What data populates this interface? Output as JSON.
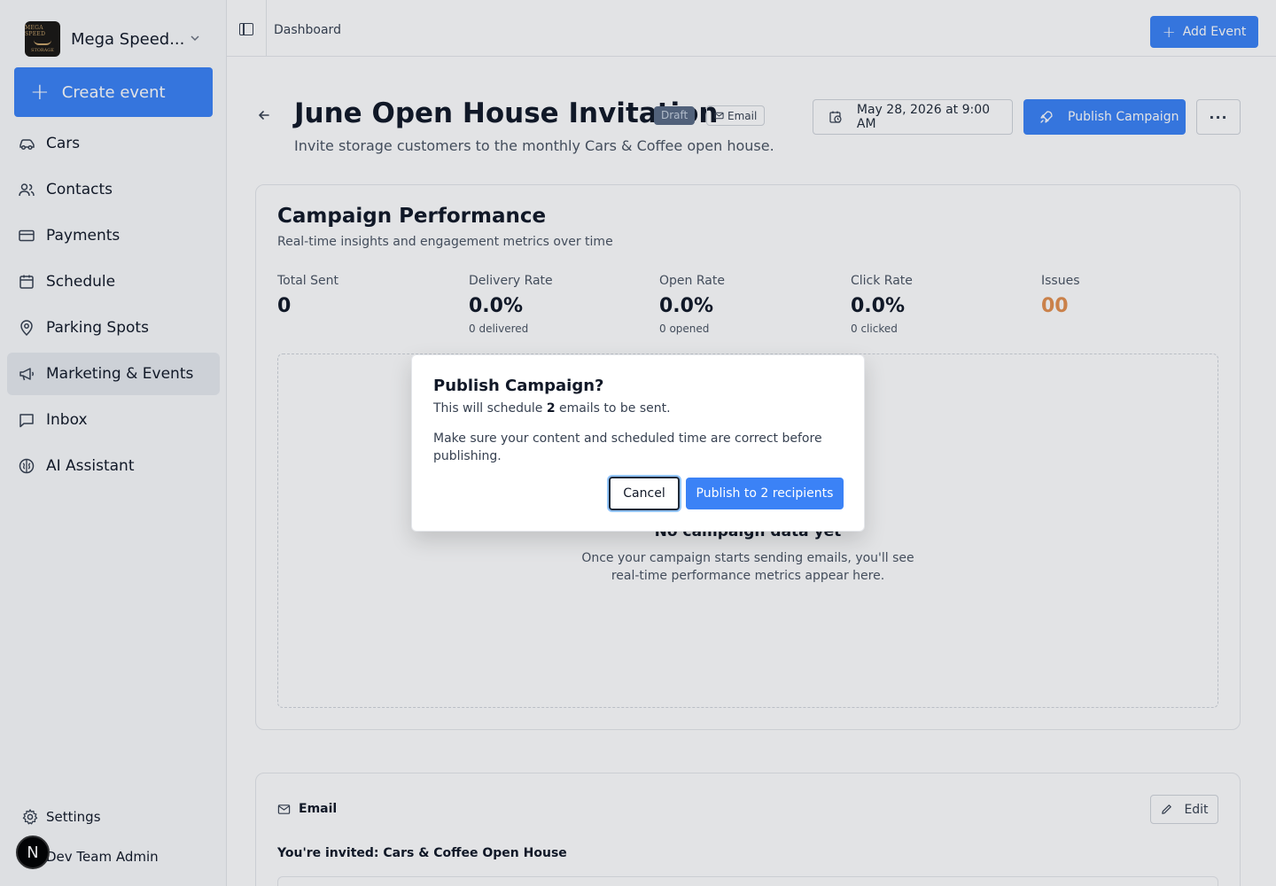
{
  "sidebar": {
    "org": {
      "name": "Mega Speed...",
      "logo_top": "MEGA SPEED",
      "logo_bottom": "STORAGE"
    },
    "create_label": "Create event",
    "items": [
      {
        "label": "Cars",
        "icon": "car-icon"
      },
      {
        "label": "Contacts",
        "icon": "users-icon"
      },
      {
        "label": "Payments",
        "icon": "credit-card-icon"
      },
      {
        "label": "Schedule",
        "icon": "calendar-icon"
      },
      {
        "label": "Parking Spots",
        "icon": "map-pin-icon"
      },
      {
        "label": "Marketing & Events",
        "icon": "megaphone-icon",
        "active": true
      },
      {
        "label": "Inbox",
        "icon": "message-square-icon"
      },
      {
        "label": "AI Assistant",
        "icon": "brain-icon"
      }
    ],
    "settings_label": "Settings",
    "user_name": "Dev Team Admin",
    "avatar_letter": "N"
  },
  "topbar": {
    "breadcrumb": "Dashboard",
    "add_event_label": "Add Event"
  },
  "campaign": {
    "title": "June Open House Invitation",
    "status_badge": "Draft",
    "channel_badge": "Email",
    "description": "Invite storage customers to the monthly Cars & Coffee open house.",
    "scheduled_at": "May 28, 2026 at 9:00 AM",
    "publish_label": "Publish Campaign",
    "more_label": "···"
  },
  "performance": {
    "title": "Campaign Performance",
    "subtitle": "Real-time insights and engagement metrics over time",
    "metrics": [
      {
        "label": "Total Sent",
        "value": "0",
        "sub": ""
      },
      {
        "label": "Delivery Rate",
        "value": "0.0%",
        "sub": "0 delivered"
      },
      {
        "label": "Open Rate",
        "value": "0.0%",
        "sub": "0 opened"
      },
      {
        "label": "Click Rate",
        "value": "0.0%",
        "sub": "0 clicked"
      },
      {
        "label": "Issues",
        "value": "00",
        "sub": ""
      }
    ],
    "empty_title": "No campaign data yet",
    "empty_desc": "Once your campaign starts sending emails, you'll see real-time performance metrics appear here."
  },
  "email_section": {
    "heading": "Email",
    "edit_label": "Edit",
    "subject": "You're invited: Cars & Coffee Open House"
  },
  "modal": {
    "title": "Publish Campaign?",
    "p1_before": "This will schedule ",
    "p1_count": "2",
    "p1_after": " emails to be sent.",
    "p2": "Make sure your content and scheduled time are correct before publishing.",
    "cancel_label": "Cancel",
    "confirm_label": "Publish to 2 recipients"
  },
  "colors": {
    "primary": "#3b82f6",
    "issues": "#e4904f",
    "draft_badge": "#5b6b86"
  }
}
